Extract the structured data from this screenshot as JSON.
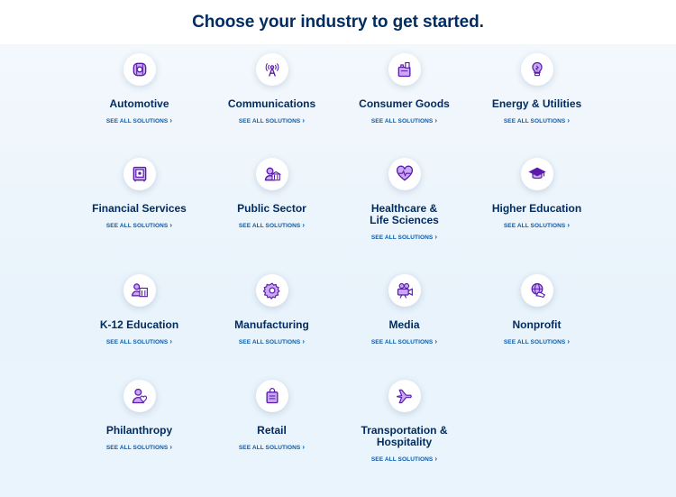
{
  "page": {
    "title": "Choose your industry to get started.",
    "link_label": "SEE ALL SOLUTIONS",
    "chevron": "›"
  },
  "colors": {
    "heading": "#032d60",
    "link": "#0b5cab",
    "icon_purple": "#5a1ba9",
    "icon_light": "#c9a9f5",
    "background": "#eaf4fc"
  },
  "industries": [
    {
      "name": "Automotive",
      "link": "SEE ALL SOLUTIONS",
      "icon": "tire-icon"
    },
    {
      "name": "Communications",
      "link": "SEE ALL SOLUTIONS",
      "icon": "antenna-icon"
    },
    {
      "name": "Consumer Goods",
      "link": "SEE ALL SOLUTIONS",
      "icon": "grocery-bag-icon"
    },
    {
      "name": "Energy & Utilities",
      "link": "SEE ALL SOLUTIONS",
      "icon": "lightbulb-icon"
    },
    {
      "name": "Financial Services",
      "link": "SEE ALL SOLUTIONS",
      "icon": "safe-icon"
    },
    {
      "name": "Public Sector",
      "link": "SEE ALL SOLUTIONS",
      "icon": "government-building-icon"
    },
    {
      "name": "Healthcare &\nLife Sciences",
      "link": "SEE ALL SOLUTIONS",
      "icon": "heart-pulse-icon"
    },
    {
      "name": "Higher Education",
      "link": "SEE ALL SOLUTIONS",
      "icon": "graduation-cap-icon"
    },
    {
      "name": "K-12 Education",
      "link": "SEE ALL SOLUTIONS",
      "icon": "school-icon"
    },
    {
      "name": "Manufacturing",
      "link": "SEE ALL SOLUTIONS",
      "icon": "gear-icon"
    },
    {
      "name": "Media",
      "link": "SEE ALL SOLUTIONS",
      "icon": "video-camera-icon"
    },
    {
      "name": "Nonprofit",
      "link": "SEE ALL SOLUTIONS",
      "icon": "globe-hands-icon"
    },
    {
      "name": "Philanthropy",
      "link": "SEE ALL SOLUTIONS",
      "icon": "person-heart-icon"
    },
    {
      "name": "Retail",
      "link": "SEE ALL SOLUTIONS",
      "icon": "shopping-bag-icon"
    },
    {
      "name": "Transportation &\nHospitality",
      "link": "SEE ALL SOLUTIONS",
      "icon": "airplane-icon"
    }
  ]
}
